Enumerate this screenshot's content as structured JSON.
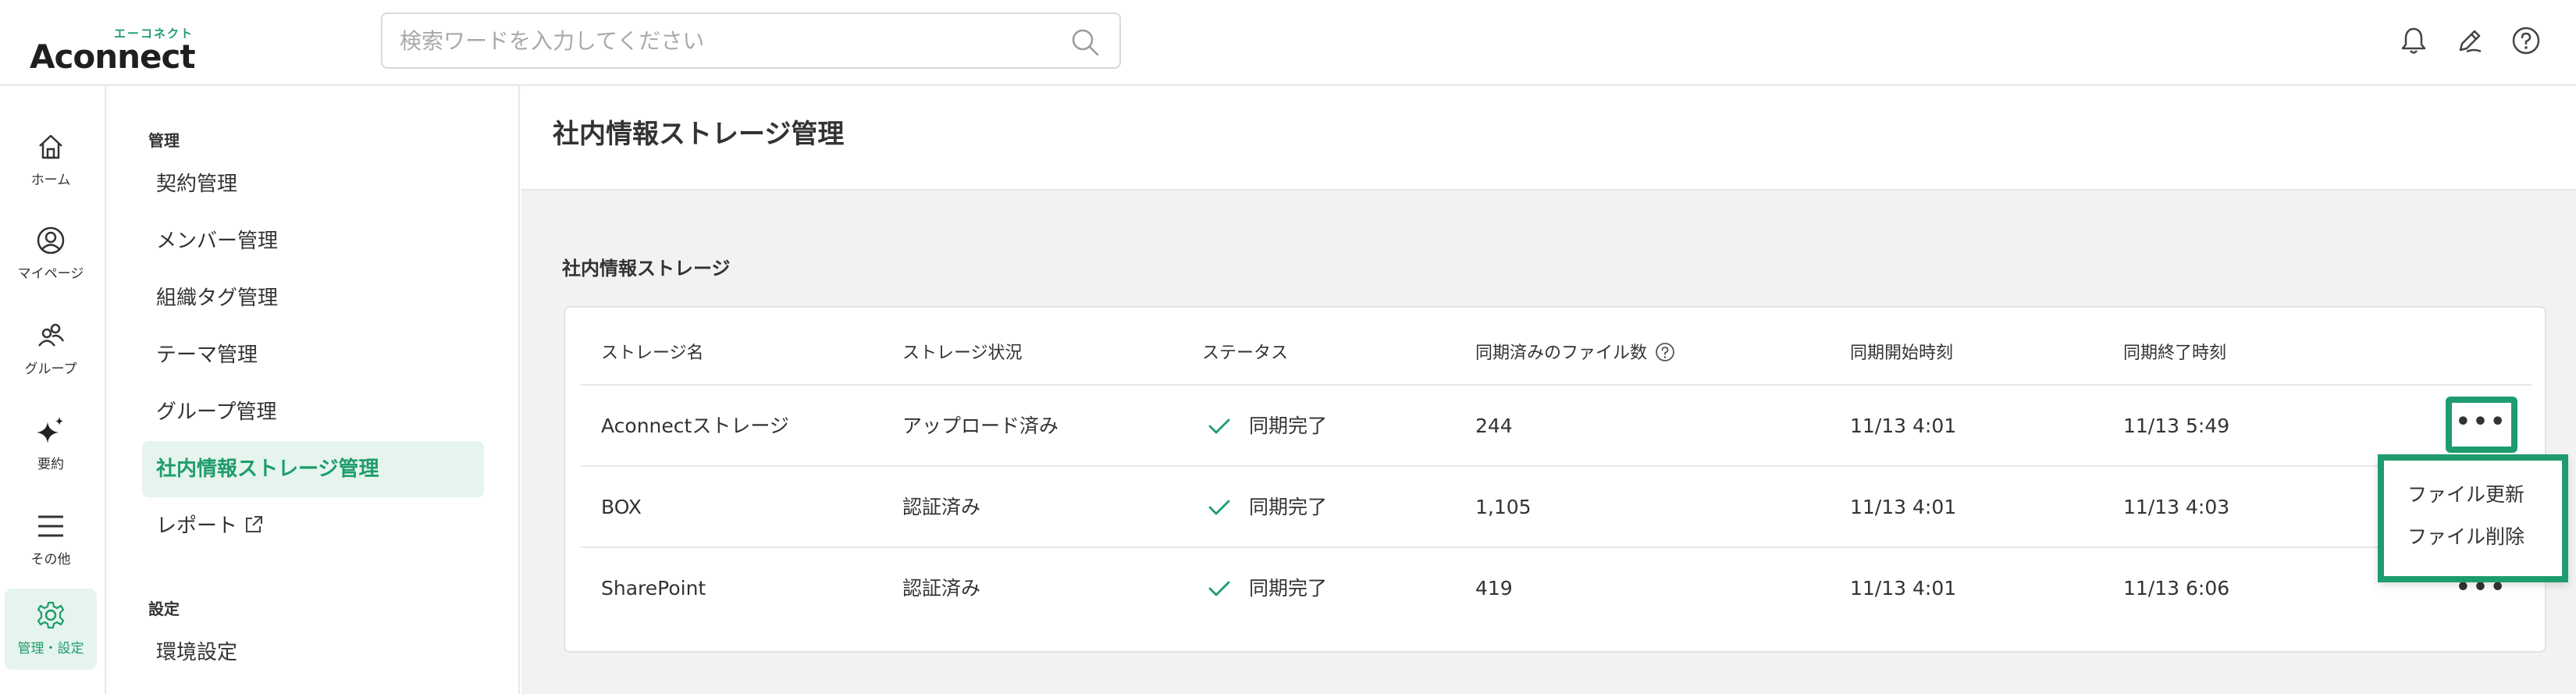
{
  "header": {
    "logo_kana": "エーコネクト",
    "logo_text": "Aconnect",
    "search_placeholder": "検索ワードを入力してください",
    "icons": [
      "bell-icon",
      "pen-icon",
      "help-icon"
    ]
  },
  "rail": {
    "items": [
      {
        "label": "ホーム",
        "icon": "home-icon"
      },
      {
        "label": "マイページ",
        "icon": "user-icon"
      },
      {
        "label": "グループ",
        "icon": "group-icon"
      },
      {
        "label": "要約",
        "icon": "sparkle-icon"
      },
      {
        "label": "その他",
        "icon": "menu-icon"
      },
      {
        "label": "管理・設定",
        "icon": "gear-icon",
        "active": true
      }
    ]
  },
  "subnav": {
    "section_admin": "管理",
    "items": [
      {
        "label": "契約管理"
      },
      {
        "label": "メンバー管理"
      },
      {
        "label": "組織タグ管理"
      },
      {
        "label": "テーマ管理"
      },
      {
        "label": "グループ管理"
      },
      {
        "label": "社内情報ストレージ管理",
        "active": true
      },
      {
        "label": "レポート",
        "external": true
      }
    ],
    "section_settings": "設定",
    "settings_items": [
      {
        "label": "環境設定"
      }
    ]
  },
  "main": {
    "page_title": "社内情報ストレージ管理",
    "section_title": "社内情報ストレージ",
    "table": {
      "headers": {
        "name": "ストレージ名",
        "state": "ストレージ状況",
        "status": "ステータス",
        "files": "同期済みのファイル数",
        "start": "同期開始時刻",
        "end": "同期終了時刻"
      },
      "rows": [
        {
          "name": "Aconnectストレージ",
          "state": "アップロード済み",
          "status": "同期完了",
          "files": "244",
          "start": "11/13 4:01",
          "end": "11/13 5:49",
          "more": "•••"
        },
        {
          "name": "BOX",
          "state": "認証済み",
          "status": "同期完了",
          "files": "1,105",
          "start": "11/13 4:01",
          "end": "11/13 4:03",
          "more": "•••"
        },
        {
          "name": "SharePoint",
          "state": "認証済み",
          "status": "同期完了",
          "files": "419",
          "start": "11/13 4:01",
          "end": "11/13 6:06",
          "more": "•••"
        }
      ]
    },
    "context_menu": {
      "items": [
        {
          "label": "ファイル更新"
        },
        {
          "label": "ファイル削除"
        }
      ]
    }
  },
  "colors": {
    "accent": "#1e9c6e",
    "active_bg": "#e6f4ee",
    "main_bg": "#f2f2f2"
  }
}
